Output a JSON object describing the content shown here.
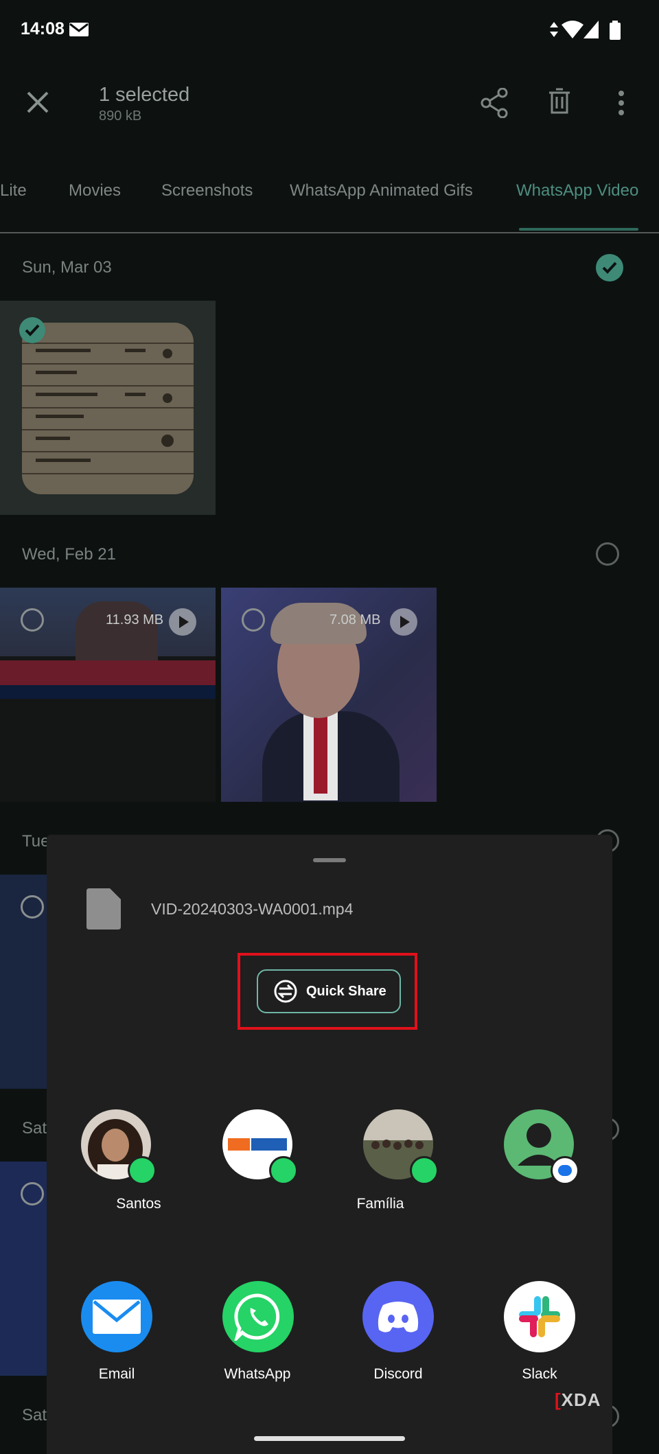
{
  "status_bar": {
    "time": "14:08"
  },
  "toolbar": {
    "selected_title": "1 selected",
    "selected_size": "890 kB"
  },
  "tabs": [
    {
      "label": "Lite"
    },
    {
      "label": "Movies"
    },
    {
      "label": "Screenshots"
    },
    {
      "label": "WhatsApp Animated Gifs"
    },
    {
      "label": "WhatsApp Video",
      "active": true
    }
  ],
  "groups": {
    "g1": {
      "date": "Sun, Mar 03"
    },
    "g2": {
      "date": "Wed, Feb 21",
      "videos": [
        {
          "size": "11.93 MB"
        },
        {
          "size": "7.08 MB"
        }
      ]
    },
    "g3": {
      "date": "Tue"
    },
    "g4": {
      "date": "Sat"
    },
    "g5": {
      "date": "Sat"
    }
  },
  "share_sheet": {
    "file_name": "VID-20240303-WA0001.mp4",
    "quick_share_label": "Quick Share",
    "contacts": [
      {
        "label": "Santos",
        "badge": "whatsapp"
      },
      {
        "label": "",
        "badge": "whatsapp"
      },
      {
        "label": "Família",
        "badge": "whatsapp"
      },
      {
        "label": "",
        "badge": "messages"
      }
    ],
    "apps": [
      {
        "label": "Email",
        "icon": "email-icon",
        "color": "#1a8cf0"
      },
      {
        "label": "WhatsApp",
        "icon": "whatsapp-icon",
        "color": "#25d366"
      },
      {
        "label": "Discord",
        "icon": "discord-icon",
        "color": "#5865f2"
      },
      {
        "label": "Slack",
        "icon": "slack-icon",
        "color": "#ffffff"
      }
    ]
  },
  "watermark": "XDA"
}
